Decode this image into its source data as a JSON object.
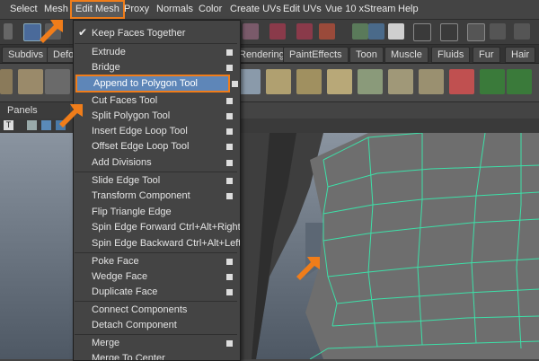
{
  "menubar": {
    "items": [
      "Select",
      "Mesh",
      "Edit Mesh",
      "Proxy",
      "Normals",
      "Color",
      "Create UVs",
      "Edit UVs",
      "Vue 10 xStream",
      "Help"
    ],
    "active_index": 2
  },
  "shelf_tabs": [
    "Subdivs",
    "Defo",
    "Rendering",
    "PaintEffects",
    "Toon",
    "Muscle",
    "Fluids",
    "Fur",
    "Hair"
  ],
  "panels_label": "Panels",
  "edit_mesh_menu": {
    "items": [
      {
        "label": "Keep Faces Together",
        "checked": true
      },
      {
        "label": "Extrude",
        "option": true
      },
      {
        "label": "Bridge",
        "option": true
      },
      {
        "label": "Append to Polygon Tool",
        "option": true,
        "highlighted": true
      },
      {
        "label": "Cut Faces Tool",
        "option": true
      },
      {
        "label": "Split Polygon Tool",
        "option": true
      },
      {
        "label": "Insert Edge Loop Tool",
        "option": true
      },
      {
        "label": "Offset Edge Loop Tool",
        "option": true
      },
      {
        "label": "Add Divisions",
        "option": true
      },
      {
        "label": "Slide Edge Tool",
        "option": true
      },
      {
        "label": "Transform Component",
        "option": true
      },
      {
        "label": "Flip Triangle Edge",
        "option": false
      },
      {
        "label": "Spin Edge Forward  Ctrl+Alt+Right",
        "option": false
      },
      {
        "label": "Spin Edge Backward  Ctrl+Alt+Left",
        "option": false
      },
      {
        "label": "Poke Face",
        "option": true
      },
      {
        "label": "Wedge Face",
        "option": true
      },
      {
        "label": "Duplicate Face",
        "option": true
      },
      {
        "label": "Connect Components",
        "option": false
      },
      {
        "label": "Detach Component",
        "option": false
      },
      {
        "label": "Merge",
        "option": true
      },
      {
        "label": "Merge To Center",
        "option": false
      }
    ]
  },
  "colors": {
    "accent_orange": "#f07d1a",
    "highlight_blue": "#5e86b8",
    "wireframe": "#3de0a8",
    "mesh_gray": "#6e6e6e",
    "background": "#5f6a76"
  },
  "icons": [
    "move-icon",
    "select-icon",
    "curve-icon",
    "magnet-icon",
    "render-icon",
    "camera-icon",
    "polygon-shelf-icons",
    "bridge-icon",
    "cube-icon"
  ]
}
